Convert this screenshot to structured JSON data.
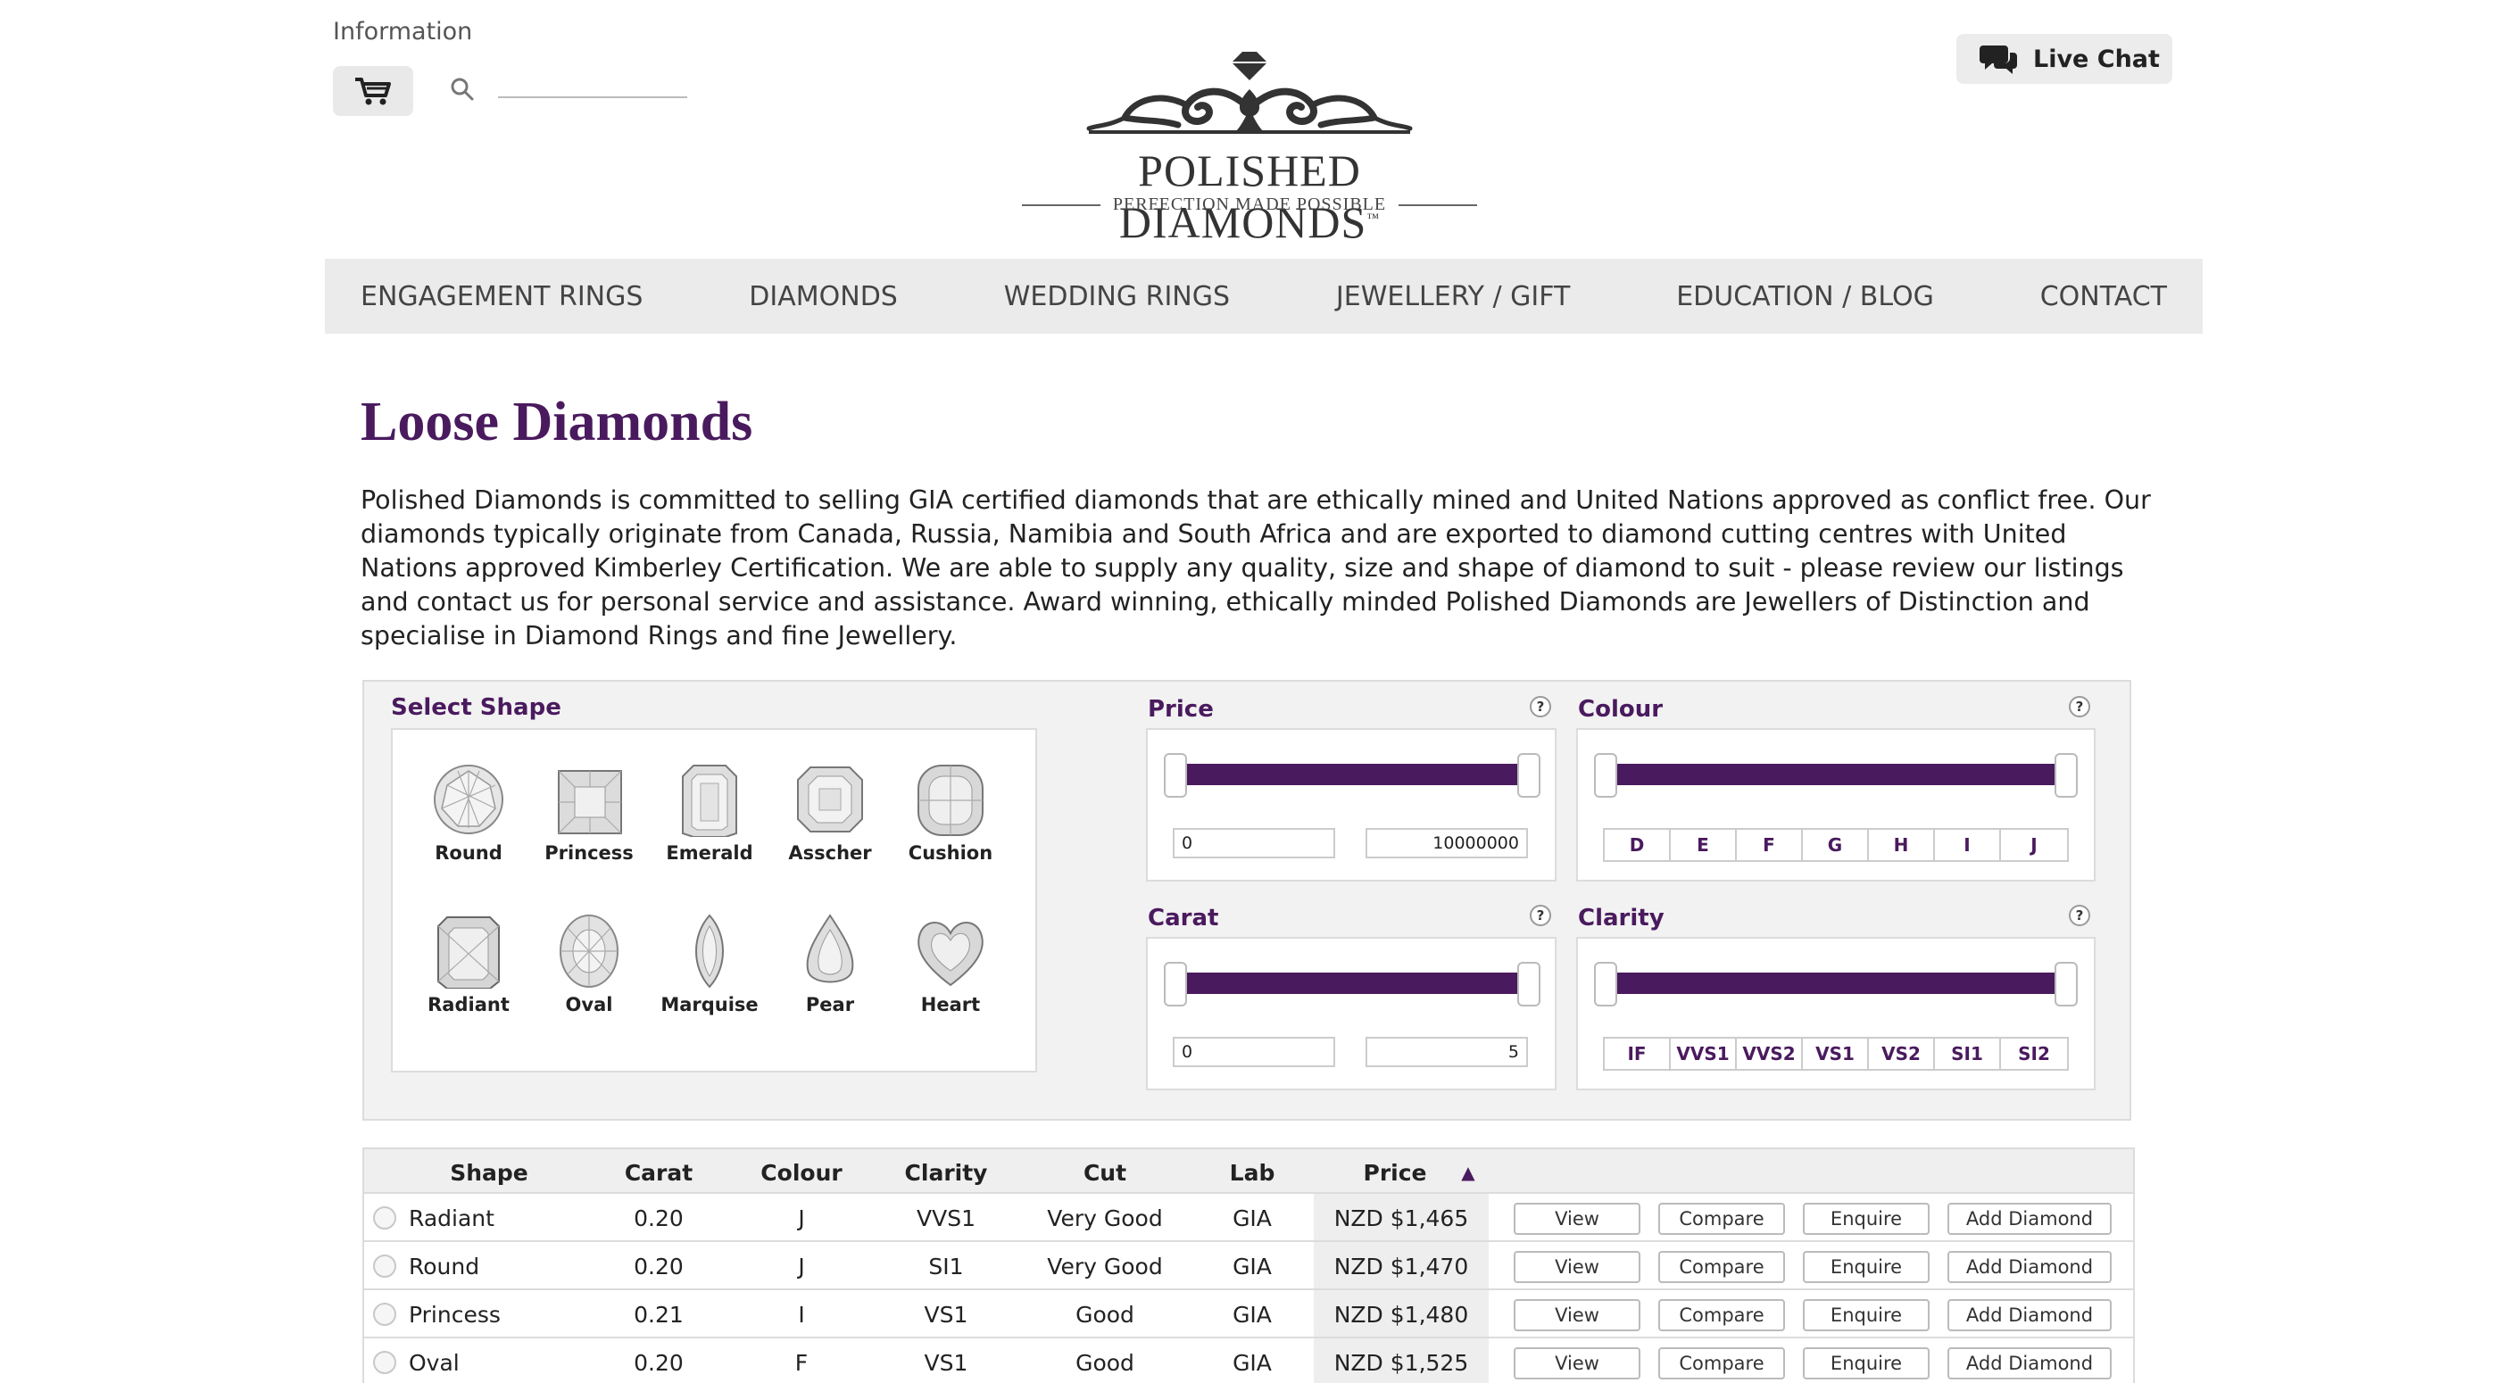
{
  "header": {
    "info_link": "Information",
    "search_placeholder": "",
    "live_chat_label": "Live Chat",
    "logo_title": "POLISHED DIAMONDS",
    "logo_tm": "™",
    "logo_tagline": "PERFECTION MADE POSSIBLE"
  },
  "nav": {
    "items": [
      "ENGAGEMENT RINGS",
      "DIAMONDS",
      "WEDDING RINGS",
      "JEWELLERY / GIFT",
      "EDUCATION / BLOG",
      "CONTACT"
    ]
  },
  "page": {
    "title": "Loose Diamonds",
    "intro": "Polished Diamonds is committed to selling GIA certified diamonds that are ethically mined and United Nations approved as conflict free. Our diamonds typically originate from Canada, Russia, Namibia and South Africa and are exported to diamond cutting centres with United Nations approved Kimberley Certification. We are able to supply any quality, size and shape of diamond to suit - please review our listings and contact us for personal service and assistance. Award winning, ethically minded Polished Diamonds are Jewellers of Distinction and specialise in Diamond Rings and fine Jewellery."
  },
  "filters": {
    "shape_heading": "Select Shape",
    "shapes": [
      "Round",
      "Princess",
      "Emerald",
      "Asscher",
      "Cushion",
      "Radiant",
      "Oval",
      "Marquise",
      "Pear",
      "Heart"
    ],
    "price": {
      "label": "Price",
      "min": "0",
      "max": "10000000"
    },
    "colour": {
      "label": "Colour",
      "grades": [
        "D",
        "E",
        "F",
        "G",
        "H",
        "I",
        "J"
      ]
    },
    "carat": {
      "label": "Carat",
      "min": "0",
      "max": "5"
    },
    "clarity": {
      "label": "Clarity",
      "grades": [
        "IF",
        "VVS1",
        "VVS2",
        "VS1",
        "VS2",
        "SI1",
        "SI2"
      ]
    },
    "help_glyph": "?"
  },
  "table": {
    "headers": [
      "Shape",
      "Carat",
      "Colour",
      "Clarity",
      "Cut",
      "Lab",
      "Price"
    ],
    "sort_indicator": "▲",
    "actions": [
      "View",
      "Compare",
      "Enquire",
      "Add Diamond"
    ],
    "rows": [
      {
        "shape": "Radiant",
        "carat": "0.20",
        "colour": "J",
        "clarity": "VVS1",
        "cut": "Very Good",
        "lab": "GIA",
        "price": "NZD $1,465"
      },
      {
        "shape": "Round",
        "carat": "0.20",
        "colour": "J",
        "clarity": "SI1",
        "cut": "Very Good",
        "lab": "GIA",
        "price": "NZD $1,470"
      },
      {
        "shape": "Princess",
        "carat": "0.21",
        "colour": "I",
        "clarity": "VS1",
        "cut": "Good",
        "lab": "GIA",
        "price": "NZD $1,480"
      },
      {
        "shape": "Oval",
        "carat": "0.20",
        "colour": "F",
        "clarity": "VS1",
        "cut": "Good",
        "lab": "GIA",
        "price": "NZD $1,525"
      }
    ]
  },
  "colors": {
    "brand_purple": "#4a1a5e",
    "panel_bg": "#f2f2f2",
    "nav_bg": "#ebebeb"
  }
}
